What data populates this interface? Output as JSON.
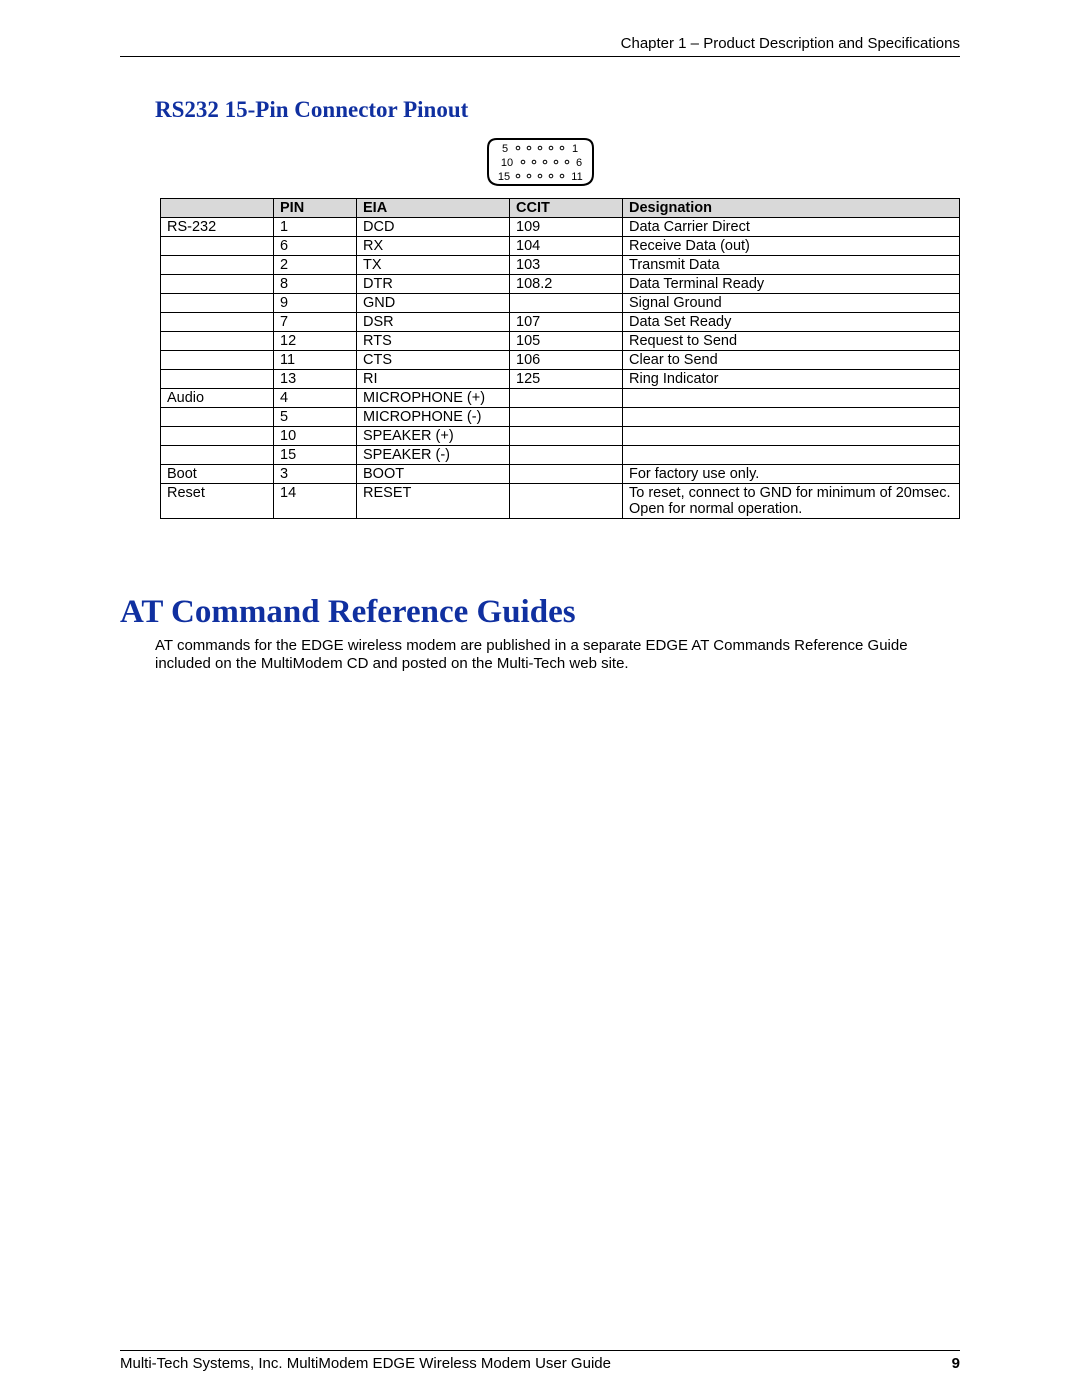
{
  "header": {
    "chapter": "Chapter 1 – Product Description and Specifications"
  },
  "section_title": "RS232 15-Pin Connector Pinout",
  "connector_pins": {
    "row1_left": "5",
    "row1_right": "1",
    "row2_left": "10",
    "row2_right": "6",
    "row3_left": "15",
    "row3_right": "11"
  },
  "table": {
    "headers": {
      "group": "",
      "pin": "PIN",
      "eia": "EIA",
      "ccit": "CCIT",
      "designation": "Designation"
    },
    "rows": [
      {
        "group": "RS-232",
        "pin": "1",
        "eia": "DCD",
        "ccit": "109",
        "designation": "Data Carrier Direct"
      },
      {
        "group": "",
        "pin": "6",
        "eia": "RX",
        "ccit": "104",
        "designation": "Receive Data (out)"
      },
      {
        "group": "",
        "pin": "2",
        "eia": "TX",
        "ccit": "103",
        "designation": "Transmit Data"
      },
      {
        "group": "",
        "pin": "8",
        "eia": "DTR",
        "ccit": "108.2",
        "designation": "Data Terminal Ready"
      },
      {
        "group": "",
        "pin": "9",
        "eia": "GND",
        "ccit": "",
        "designation": "Signal Ground"
      },
      {
        "group": "",
        "pin": "7",
        "eia": "DSR",
        "ccit": "107",
        "designation": "Data Set Ready"
      },
      {
        "group": "",
        "pin": "12",
        "eia": "RTS",
        "ccit": "105",
        "designation": "Request to Send"
      },
      {
        "group": "",
        "pin": "11",
        "eia": "CTS",
        "ccit": "106",
        "designation": "Clear to Send"
      },
      {
        "group": "",
        "pin": "13",
        "eia": "RI",
        "ccit": "125",
        "designation": "Ring Indicator"
      },
      {
        "group": "Audio",
        "pin": "4",
        "eia": "MICROPHONE (+)",
        "ccit": "",
        "designation": ""
      },
      {
        "group": "",
        "pin": "5",
        "eia": "MICROPHONE (-)",
        "ccit": "",
        "designation": ""
      },
      {
        "group": "",
        "pin": "10",
        "eia": "SPEAKER (+)",
        "ccit": "",
        "designation": ""
      },
      {
        "group": "",
        "pin": "15",
        "eia": "SPEAKER (-)",
        "ccit": "",
        "designation": ""
      },
      {
        "group": "Boot",
        "pin": "3",
        "eia": "BOOT",
        "ccit": "",
        "designation": "For factory use only."
      },
      {
        "group": "Reset",
        "pin": "14",
        "eia": "RESET",
        "ccit": "",
        "designation": "To reset, connect to GND for minimum of 20msec.  Open for normal operation."
      }
    ]
  },
  "main_heading": "AT Command Reference Guides",
  "body_text": "AT commands for the EDGE wireless modem are published in a separate EDGE AT Commands Reference Guide included on the MultiModem CD and posted on the Multi-Tech web site.",
  "footer": {
    "text": "Multi-Tech Systems, Inc. MultiModem EDGE Wireless Modem User Guide",
    "page": "9"
  }
}
